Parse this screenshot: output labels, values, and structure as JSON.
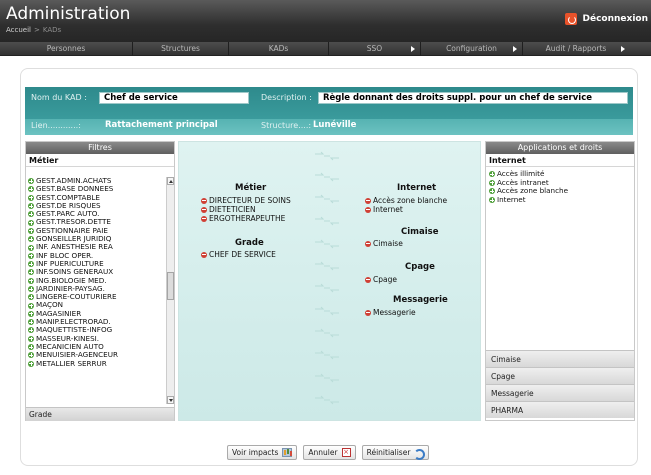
{
  "header": {
    "app_title": "Administration",
    "breadcrumb": [
      "Accueil",
      "KADs"
    ],
    "logout_label": "Déconnexion"
  },
  "nav": {
    "items": [
      {
        "label": "Personnes",
        "has_submenu": false
      },
      {
        "label": "Structures",
        "has_submenu": false
      },
      {
        "label": "KADs",
        "has_submenu": false
      },
      {
        "label": "SSO",
        "has_submenu": true
      },
      {
        "label": "Configuration",
        "has_submenu": true
      },
      {
        "label": "Audit / Rapports",
        "has_submenu": true
      }
    ]
  },
  "kad": {
    "name_label": "Nom du KAD :",
    "name_value": "Chef de service",
    "description_label": "Description :",
    "description_value": "Règle donnant des droits suppl. pour un chef de service",
    "link_label": "Lien............:",
    "link_value": "Rattachement principal",
    "structure_label": "Structure....:",
    "structure_value": "Lunéville"
  },
  "filters": {
    "title": "Filtres",
    "category": "Métier",
    "items": [
      "GEST.ADMIN.ACHATS",
      "GEST.BASE DONNEES",
      "GEST.COMPTABLE",
      "GEST.DE RISQUES",
      "GEST.PARC AUTO.",
      "GEST.TRESOR.DETTE",
      "GESTIONNAIRE PAIE",
      "GONSEILLER JURIDIQ",
      "INF. ANESTHESIE REA",
      "INF BLOC OPER.",
      "INF PUERICULTURE",
      "INF.SOINS GENERAUX",
      "ING.BIOLOGIE MED.",
      "JARDINIER-PAYSAG.",
      "LINGERE-COUTURIERE",
      "MAÇON",
      "MAGASINIER",
      "MANIP.ELECTRORAD.",
      "MAQUETTISTE-INFOG",
      "MASSEUR-KINESI.",
      "MECANICIEN AUTO",
      "MENUISIER-AGENCEUR",
      "METALLIER SERRUR"
    ],
    "footer": "Grade"
  },
  "selection": {
    "metier": {
      "title": "Métier",
      "items": [
        "DIRECTEUR DE SOINS",
        "DIETETICIEN",
        "ERGOTHERAPEUTHE"
      ]
    },
    "grade": {
      "title": "Grade",
      "items": [
        "CHEF DE SERVICE"
      ]
    },
    "internet": {
      "title": "Internet",
      "items": [
        "Accès zone blanche",
        "Internet"
      ]
    },
    "cimaise": {
      "title": "Cimaise",
      "items": [
        "Cimaise"
      ]
    },
    "cpage": {
      "title": "Cpage",
      "items": [
        "Cpage"
      ]
    },
    "messagerie": {
      "title": "Messagerie",
      "items": [
        "Messagerie"
      ]
    }
  },
  "applications": {
    "title": "Applications et droits",
    "category": "Internet",
    "items": [
      "Accès illimité",
      "Accès intranet",
      "Accès zone blanche",
      "Internet"
    ],
    "sections": [
      "Cimaise",
      "Cpage",
      "Messagerie",
      "PHARMA"
    ]
  },
  "buttons": {
    "impacts": "Voir impacts",
    "cancel": "Annuler",
    "reset": "Réinitialiser"
  },
  "colors": {
    "accent_teal": "#3c9c9d",
    "add": "#4f9f3a",
    "remove": "#d04035",
    "logout_icon": "#e8522a"
  }
}
